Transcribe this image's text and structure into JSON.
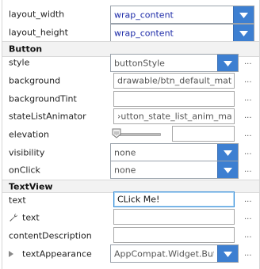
{
  "layout": {
    "width": {
      "label": "layout_width",
      "value": "wrap_content"
    },
    "height": {
      "label": "layout_height",
      "value": "wrap_content"
    }
  },
  "button_section": {
    "title": "Button",
    "style": {
      "label": "style",
      "value": "buttonStyle"
    },
    "background": {
      "label": "background",
      "value": "drawable/btn_default_mate"
    },
    "background_tint": {
      "label": "backgroundTint",
      "value": ""
    },
    "state_list_animator": {
      "label": "stateListAnimator",
      "value": "›utton_state_list_anim_mate"
    },
    "elevation": {
      "label": "elevation",
      "value": ""
    },
    "visibility": {
      "label": "visibility",
      "value": "none"
    },
    "on_click": {
      "label": "onClick",
      "value": "none"
    }
  },
  "textview_section": {
    "title": "TextView",
    "text": {
      "label": "text",
      "value": "CLick Me!"
    },
    "tools_text": {
      "label": "text",
      "value": ""
    },
    "content_description": {
      "label": "contentDescription",
      "value": ""
    },
    "text_appearance": {
      "label": "textAppearance",
      "value": "AppCompat.Widget.Button"
    }
  },
  "more_label": "...",
  "icons": {
    "dropdown": "chevron-down-icon",
    "tools": "wrench-icon",
    "expand": "expand-arrow-icon",
    "slider": "slider-thumb-icon"
  },
  "colors": {
    "accent": "#3d7fd1",
    "bound_value": "#1d2ba8",
    "section_bg": "#f2f2f2"
  }
}
